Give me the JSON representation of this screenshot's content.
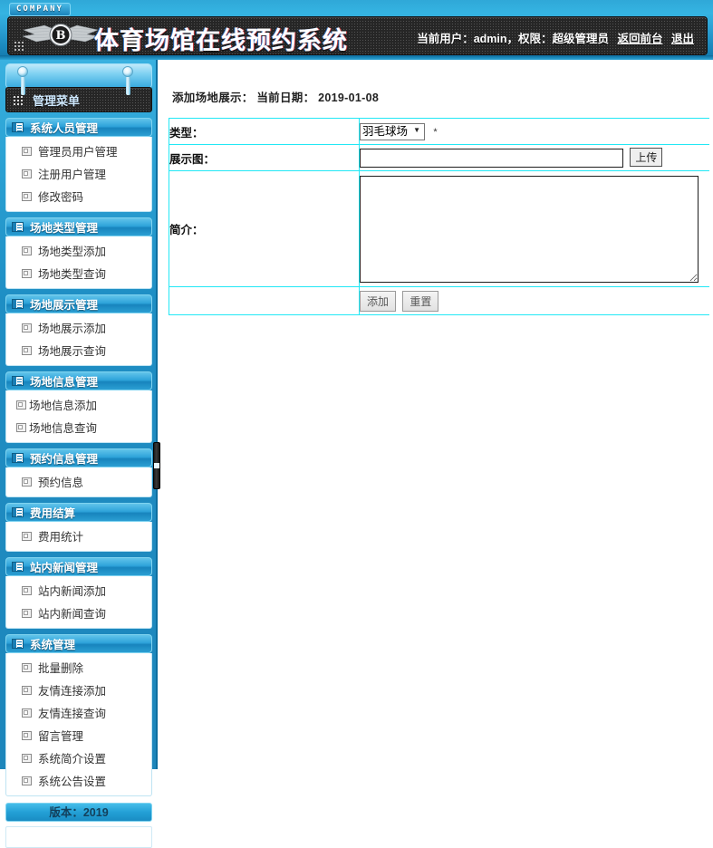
{
  "banner": {
    "company_tag": "COMPANY",
    "site_title": "体育场馆在线预约系统",
    "logo_letter": "B",
    "user_info": "当前用户：admin，权限：超级管理员",
    "link_front": "返回前台",
    "link_logout": "退出"
  },
  "sidebar": {
    "menu_header": "管理菜单",
    "version": "版本：2019",
    "groups": [
      {
        "title": "系统人员管理",
        "items": [
          {
            "label": "管理员用户管理",
            "tight": false
          },
          {
            "label": "注册用户管理",
            "tight": false
          },
          {
            "label": "修改密码",
            "tight": false
          }
        ]
      },
      {
        "title": "场地类型管理",
        "items": [
          {
            "label": "场地类型添加",
            "tight": false
          },
          {
            "label": "场地类型查询",
            "tight": false
          }
        ]
      },
      {
        "title": "场地展示管理",
        "items": [
          {
            "label": "场地展示添加",
            "tight": false
          },
          {
            "label": "场地展示查询",
            "tight": false
          }
        ]
      },
      {
        "title": "场地信息管理",
        "items": [
          {
            "label": "场地信息添加",
            "tight": true
          },
          {
            "label": "场地信息查询",
            "tight": true
          }
        ]
      },
      {
        "title": "预约信息管理",
        "items": [
          {
            "label": "预约信息",
            "tight": false
          }
        ]
      },
      {
        "title": "费用结算",
        "items": [
          {
            "label": "费用统计",
            "tight": false
          }
        ]
      },
      {
        "title": "站内新闻管理",
        "items": [
          {
            "label": "站内新闻添加",
            "tight": false
          },
          {
            "label": "站内新闻查询",
            "tight": false
          }
        ]
      },
      {
        "title": "系统管理",
        "items": [
          {
            "label": "批量删除",
            "tight": false
          },
          {
            "label": "友情连接添加",
            "tight": false
          },
          {
            "label": "友情连接查询",
            "tight": false
          },
          {
            "label": "留言管理",
            "tight": false
          },
          {
            "label": "系统简介设置",
            "tight": false
          },
          {
            "label": "系统公告设置",
            "tight": false
          }
        ]
      }
    ]
  },
  "main": {
    "breadcrumb": "添加场地展示： 当前日期： 2019-01-08",
    "form": {
      "type_label": "类型：",
      "type_value": "羽毛球场",
      "type_options": [
        "羽毛球场"
      ],
      "type_required_mark": "*",
      "image_label": "展示图：",
      "image_value": "",
      "upload_button": "上传",
      "intro_label": "简介：",
      "intro_value": "",
      "submit_button": "添加",
      "reset_button": "重置"
    }
  },
  "colors": {
    "banner_blue": "#2ba4d6",
    "sidebar_blue": "#1e8ec4",
    "table_border_cyan": "#22e8f5",
    "plate_dark": "#262626"
  }
}
